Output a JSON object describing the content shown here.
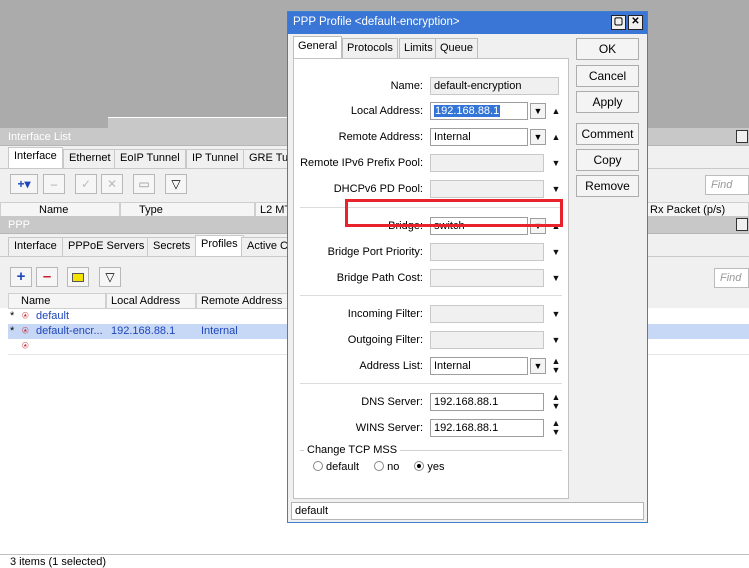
{
  "interface_window": {
    "title": "Interface List",
    "tabs": [
      "Interface",
      "Ethernet",
      "EoIP Tunnel",
      "IP Tunnel",
      "GRE Tu"
    ],
    "find_placeholder": "Find",
    "columns": [
      "Name",
      "Type",
      "L2 MT",
      "Rx Packet (p/s)"
    ]
  },
  "ppp_window": {
    "title": "PPP",
    "tabs": [
      "Interface",
      "PPPoE Servers",
      "Secrets",
      "Profiles",
      "Active C"
    ],
    "find_placeholder": "Find",
    "columns": [
      "Name",
      "Local Address",
      "Remote Address"
    ],
    "rows": [
      {
        "marker": "*",
        "name": "default",
        "local": "",
        "remote": ""
      },
      {
        "marker": "*",
        "name": "default-encr...",
        "local": "192.168.88.1",
        "remote": "Internal"
      },
      {
        "marker": "",
        "name": "",
        "local": "",
        "remote": ""
      }
    ],
    "status": "3 items (1 selected)"
  },
  "dialog": {
    "title": "PPP Profile <default-encryption>",
    "tabs": [
      "General",
      "Protocols",
      "Limits",
      "Queue"
    ],
    "fields": {
      "name": {
        "label": "Name:",
        "value": "default-encryption"
      },
      "local_address": {
        "label": "Local Address:",
        "value": "192.168.88.1"
      },
      "remote_address": {
        "label": "Remote Address:",
        "value": "Internal"
      },
      "remote_ipv6_pool": {
        "label": "Remote IPv6 Prefix Pool:",
        "value": ""
      },
      "dhcpv6_pd_pool": {
        "label": "DHCPv6 PD Pool:",
        "value": ""
      },
      "bridge": {
        "label": "Bridge:",
        "value": "switch"
      },
      "bridge_port_priority": {
        "label": "Bridge Port Priority:",
        "value": ""
      },
      "bridge_path_cost": {
        "label": "Bridge Path Cost:",
        "value": ""
      },
      "incoming_filter": {
        "label": "Incoming Filter:",
        "value": ""
      },
      "outgoing_filter": {
        "label": "Outgoing Filter:",
        "value": ""
      },
      "address_list": {
        "label": "Address List:",
        "value": "Internal"
      },
      "dns_server": {
        "label": "DNS Server:",
        "value": "192.168.88.1"
      },
      "wins_server": {
        "label": "WINS Server:",
        "value": "192.168.88.1"
      }
    },
    "tcp_mss": {
      "legend": "Change TCP MSS",
      "options": [
        "default",
        "no",
        "yes"
      ],
      "selected": "yes"
    },
    "buttons": {
      "ok": "OK",
      "cancel": "Cancel",
      "apply": "Apply",
      "comment": "Comment",
      "copy": "Copy",
      "remove": "Remove"
    },
    "status": "default",
    "highlight_color": "#e8232c"
  }
}
